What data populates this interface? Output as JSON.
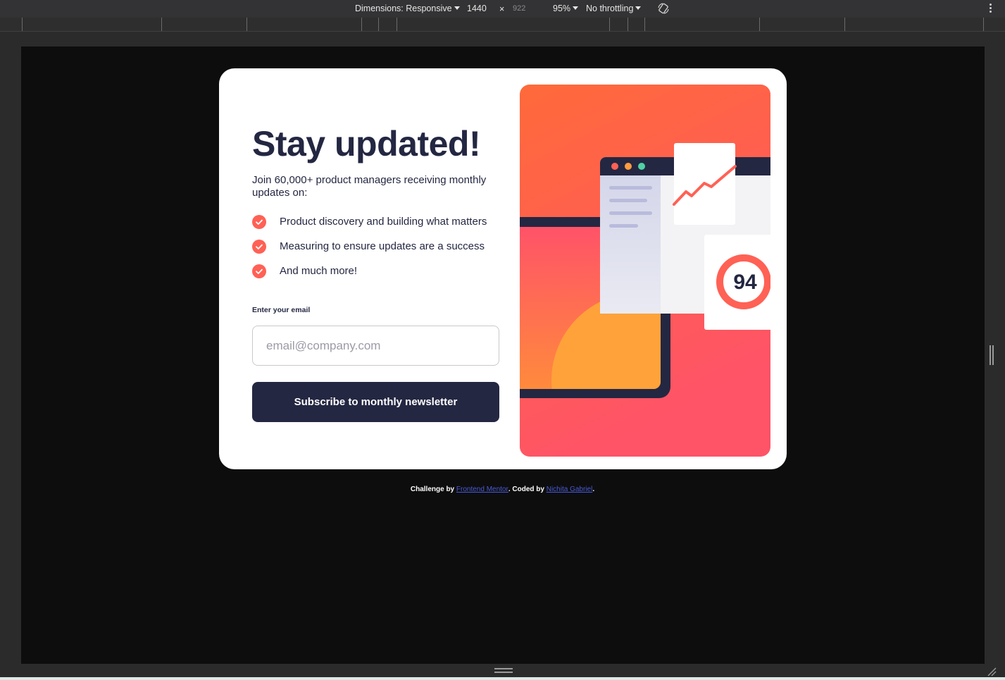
{
  "devtools": {
    "dimensions_label": "Dimensions: Responsive",
    "width_value": "1440",
    "times_sign": "×",
    "height_value": "922",
    "zoom_label": "95%",
    "throttling_label": "No throttling"
  },
  "card": {
    "title": "Stay updated!",
    "intro": "Join 60,000+ product managers receiving monthly updates on:",
    "bullets": [
      {
        "label": "Product discovery and building what matters"
      },
      {
        "label": "Measuring to ensure updates are a success"
      },
      {
        "label": "And much more!"
      }
    ],
    "email_label": "Enter your email",
    "email_placeholder": "email@company.com",
    "email_value": "",
    "subscribe_label": "Subscribe to monthly newsletter",
    "illustration_score": "94"
  },
  "footer": {
    "challenge_text": "Challenge by ",
    "challenge_link": "Frontend Mentor",
    "coded_text": ". Coded by ",
    "coder_link": "Nichita Gabriel",
    "end_text": "."
  },
  "colors": {
    "accent": "#ff6155",
    "dark_navy": "#242742",
    "background": "#0d0d0d",
    "card": "#ffffff"
  },
  "icons": {
    "check": "check-circle-icon",
    "rotate": "rotate-device-icon",
    "menu": "kebab-menu-icon"
  }
}
